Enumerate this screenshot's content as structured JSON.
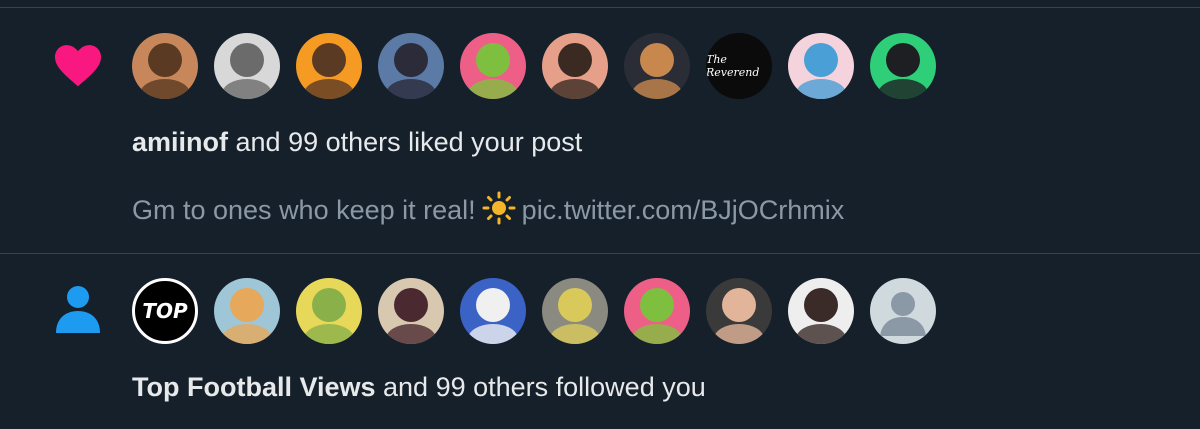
{
  "likes": {
    "actor": "amiinof",
    "message": " and 99 others liked your post",
    "post_preview": "Gm to ones who keep it real!",
    "post_link": "pic.twitter.com/BJjOCrhmix",
    "icon": "heart-icon",
    "icon_color": "#f91880",
    "avatars": [
      {
        "name": "avatar-1",
        "bg": "#c8875a",
        "face": "#5a3a22"
      },
      {
        "name": "avatar-2",
        "bg": "#d8d8d8",
        "face": "#6b6b6b"
      },
      {
        "name": "avatar-3",
        "bg": "#f59a23",
        "face": "#5b3a24"
      },
      {
        "name": "avatar-4",
        "bg": "#5b7aa6",
        "face": "#2b2b3a"
      },
      {
        "name": "avatar-5",
        "bg": "#ee5f88",
        "face": "#7fbf3f"
      },
      {
        "name": "avatar-6",
        "bg": "#e6a08a",
        "face": "#3a2a22"
      },
      {
        "name": "avatar-7",
        "bg": "#2a2d35",
        "face": "#c7874d"
      },
      {
        "name": "avatar-8",
        "bg": "#0b0b0b",
        "face": "#0b0b0b",
        "text": "The Reverend"
      },
      {
        "name": "avatar-9",
        "bg": "#f4d3dc",
        "face": "#4a9fd6"
      },
      {
        "name": "avatar-10",
        "bg": "#2fcf7a",
        "face": "#1d1f22"
      }
    ]
  },
  "follows": {
    "actor": "Top Football Views",
    "message": " and 99 others followed you",
    "icon": "person-icon",
    "icon_color": "#1d9bf0",
    "avatars": [
      {
        "name": "avatar-top",
        "bg": "#000000",
        "face": "#000000",
        "text": "TOP"
      },
      {
        "name": "avatar-12",
        "bg": "#9ec6d6",
        "face": "#e6a85a"
      },
      {
        "name": "avatar-13",
        "bg": "#e8d85a",
        "face": "#8ab04a"
      },
      {
        "name": "avatar-14",
        "bg": "#d9c8b0",
        "face": "#4a2a30"
      },
      {
        "name": "avatar-15",
        "bg": "#3b63c6",
        "face": "#f0f0f0"
      },
      {
        "name": "avatar-16",
        "bg": "#8a8a80",
        "face": "#d9c95a"
      },
      {
        "name": "avatar-17",
        "bg": "#ee5f88",
        "face": "#7fbf3f"
      },
      {
        "name": "avatar-18",
        "bg": "#3a3a3a",
        "face": "#e2b59a"
      },
      {
        "name": "avatar-19",
        "bg": "#eeeeee",
        "face": "#3a2a28"
      },
      {
        "name": "avatar-default",
        "bg": "#cfd9de",
        "face": "#8b98a5"
      }
    ]
  }
}
